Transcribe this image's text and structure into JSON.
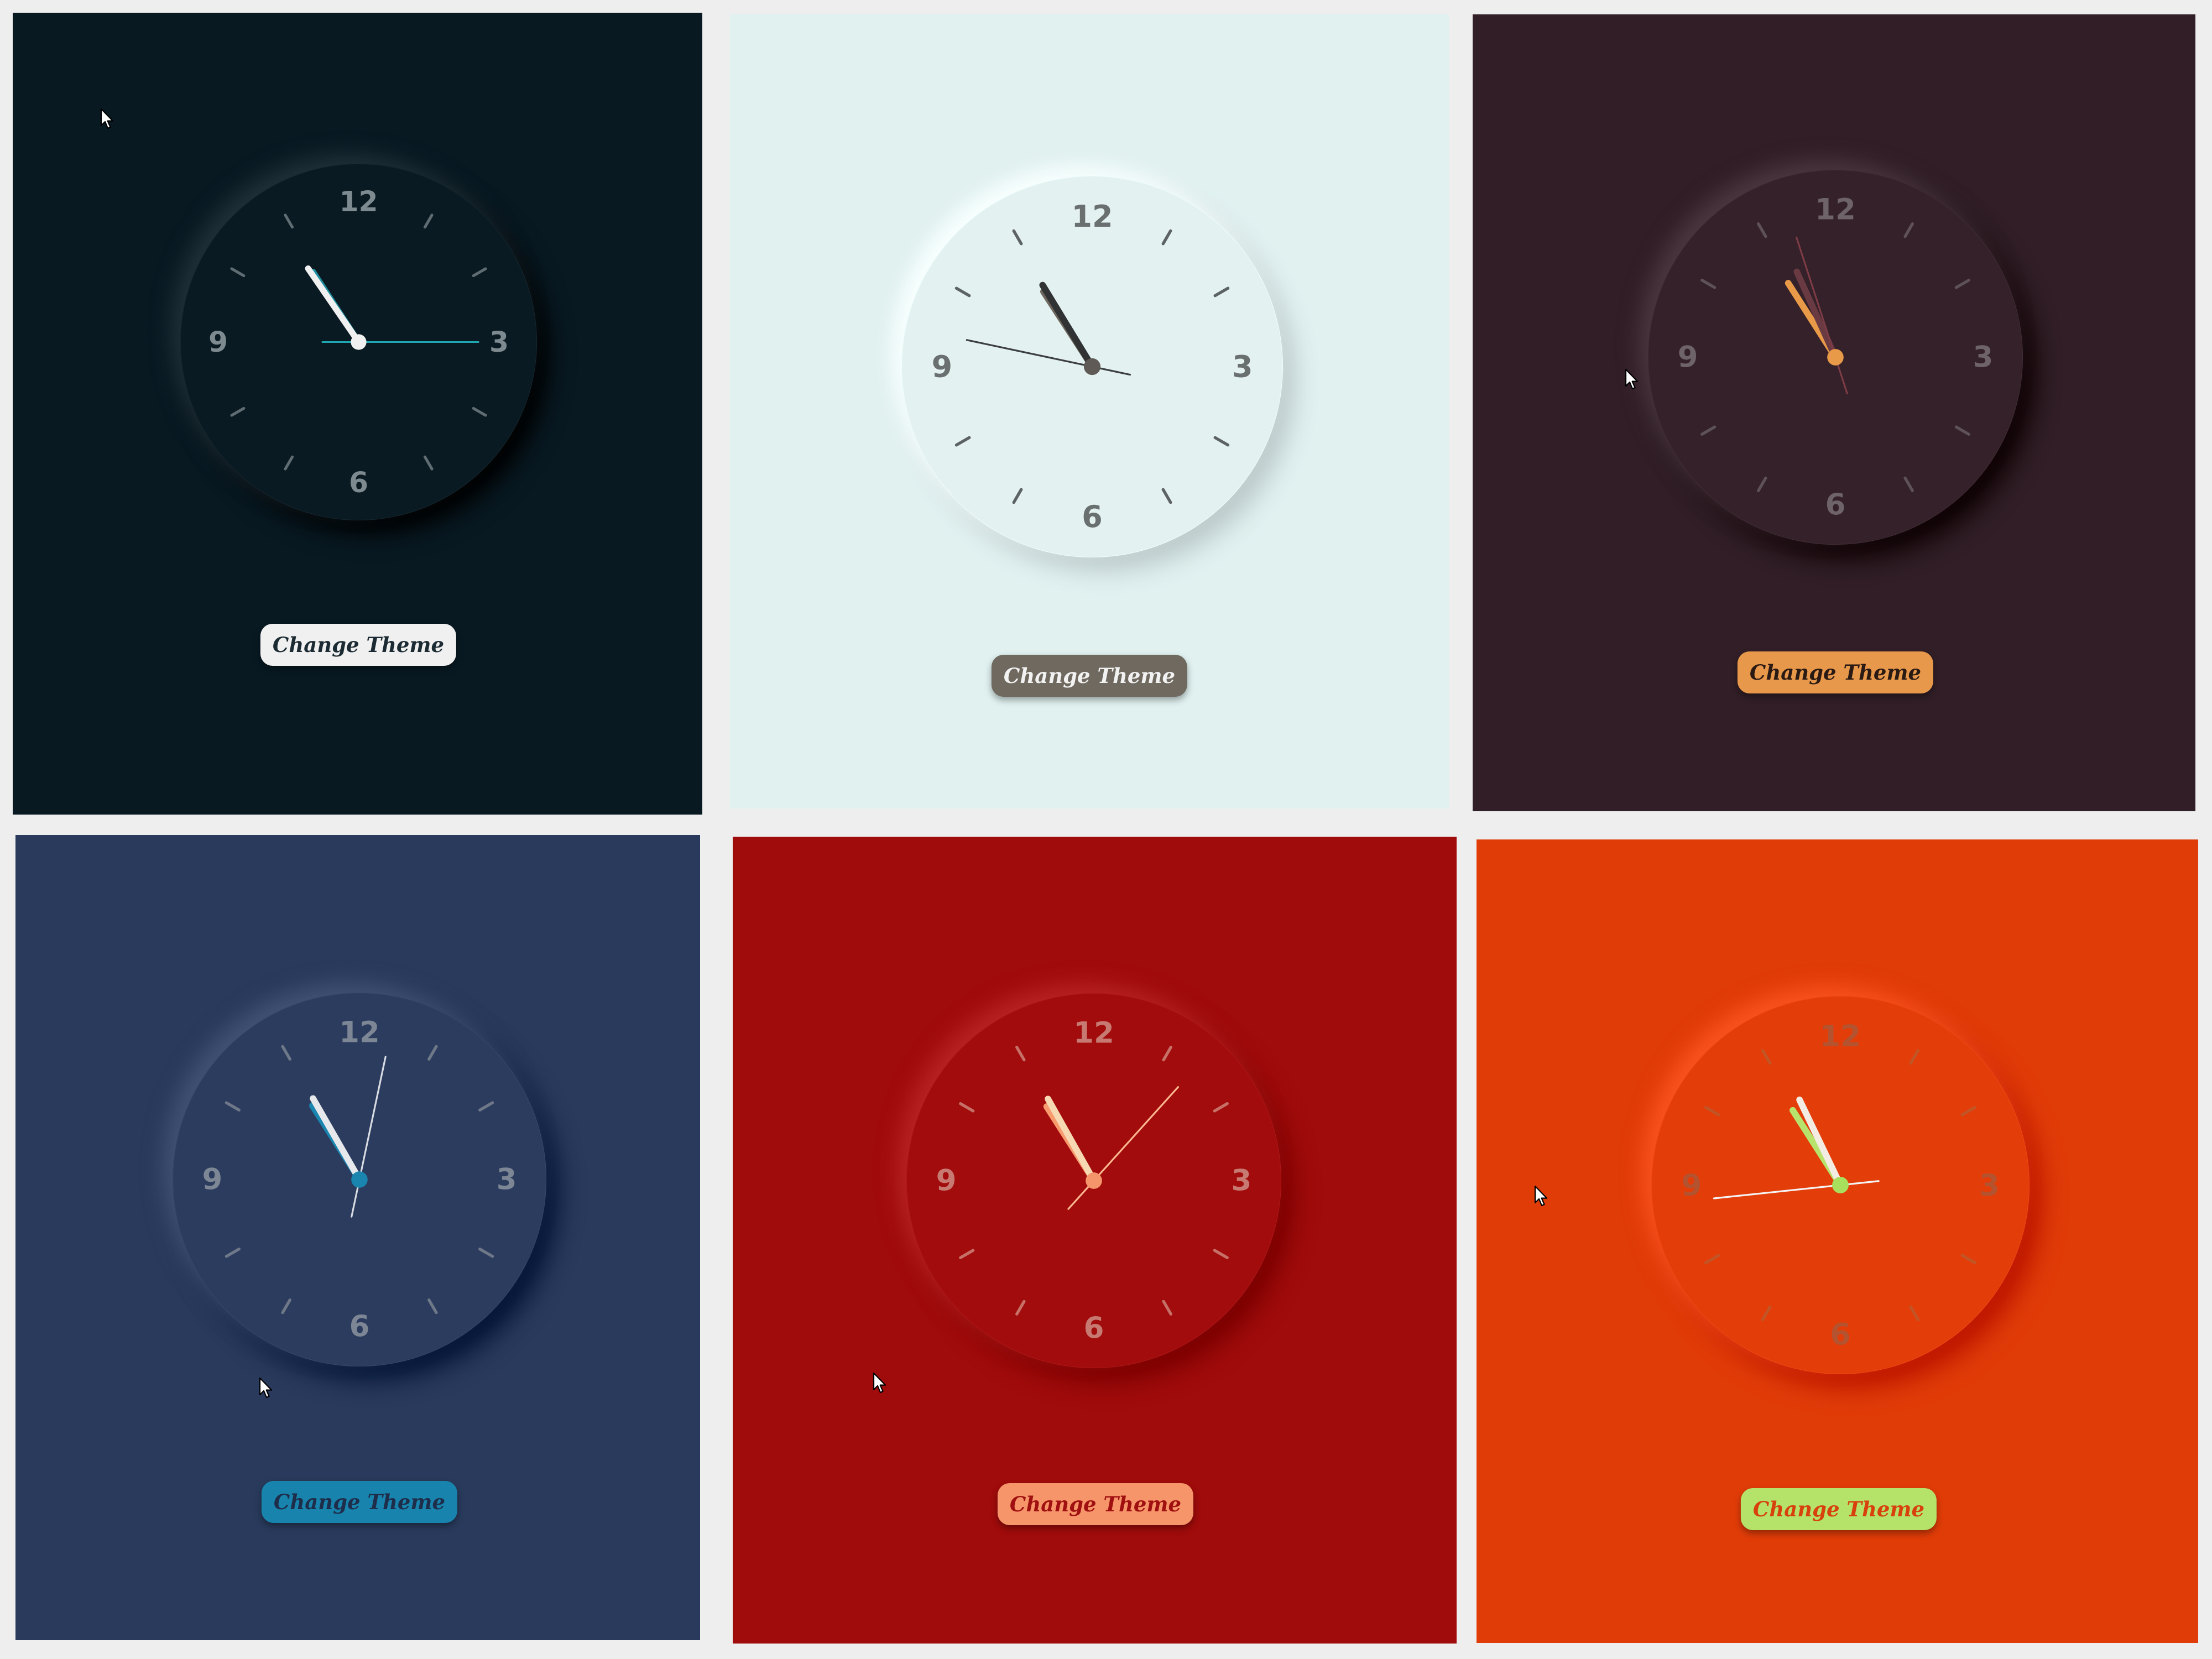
{
  "panels": [
    {
      "id": "panel-1",
      "background": "#081922",
      "clock": {
        "face": "#0a1a22",
        "numbers": "#7d8a8f",
        "ticks": "#5f6d73",
        "hour_hand": "#1f8e9e",
        "minute_hand": "#f0f0f0",
        "second_hand": "#1fa6b0",
        "center": "#f0f0f0",
        "time": {
          "hours": 10,
          "minutes": 54,
          "seconds": 15
        }
      },
      "button": {
        "label": "Change Theme",
        "bg": "#f0f0f0",
        "fg": "#1c2b33"
      },
      "cursor_icon": "arrow-cursor-icon"
    },
    {
      "id": "panel-2",
      "background": "#e0f1f0",
      "clock": {
        "face": "#e3f1f1",
        "numbers": "#6a6f70",
        "ticks": "#5d6263",
        "hour_hand": "#6e675d",
        "minute_hand": "#303234",
        "second_hand": "#3c3f40",
        "center": "#5f5a55",
        "time": {
          "hours": 10,
          "minutes": 54,
          "seconds": 47
        }
      },
      "button": {
        "label": "Change Theme",
        "bg": "#6f695f",
        "fg": "#f2f2f2"
      }
    },
    {
      "id": "panel-3",
      "background": "#311e26",
      "clock": {
        "face": "#34212a",
        "numbers": "#6e6368",
        "ticks": "#5e5257",
        "hour_hand": "#e89a48",
        "minute_hand": "#6a3a42",
        "second_hand": "#7d3c45",
        "center": "#e89a48",
        "time": {
          "hours": 10,
          "minutes": 55,
          "seconds": 57
        }
      },
      "button": {
        "label": "Change Theme",
        "bg": "#e8984a",
        "fg": "#2a1a14"
      },
      "cursor_icon": "arrow-cursor-icon"
    },
    {
      "id": "panel-4",
      "background": "#293a5c",
      "clock": {
        "face": "#2b3c5e",
        "numbers": "#7d8694",
        "ticks": "#6f7888",
        "hour_hand": "#1a86b0",
        "minute_hand": "#e6e8ec",
        "second_hand": "#d8dbe2",
        "center": "#1a86b0",
        "time": {
          "hours": 10,
          "minutes": 55,
          "seconds": 2
        }
      },
      "button": {
        "label": "Change Theme",
        "bg": "#1884ad",
        "fg": "#1e2d4a"
      },
      "cursor_icon": "arrow-cursor-icon"
    },
    {
      "id": "panel-5",
      "background": "#a00b0b",
      "clock": {
        "face": "#a20c0c",
        "numbers": "#c77a72",
        "ticks": "#c67068",
        "hour_hand": "#f79a6e",
        "minute_hand": "#f6d9b2",
        "second_hand": "#f9b890",
        "center": "#f5956b",
        "time": {
          "hours": 10,
          "minutes": 55,
          "seconds": 7
        }
      },
      "button": {
        "label": "Change Theme",
        "bg": "#f6946a",
        "fg": "#a01010"
      },
      "cursor_icon": "arrow-cursor-icon"
    },
    {
      "id": "panel-6",
      "background": "#e03c08",
      "clock": {
        "face": "#e33d09",
        "numbers": "#b3532f",
        "ticks": "#c25526",
        "hour_hand": "#b7e36c",
        "minute_hand": "#f3ece2",
        "second_hand": "#f5f5f5",
        "center": "#a8df5c",
        "time": {
          "hours": 10,
          "minutes": 55,
          "seconds": 44
        }
      },
      "button": {
        "label": "Change Theme",
        "bg": "#b5e36a",
        "fg": "#d8400c"
      },
      "cursor_icon": "arrow-cursor-icon"
    }
  ],
  "clock_numbers": [
    "12",
    "3",
    "6",
    "9"
  ]
}
